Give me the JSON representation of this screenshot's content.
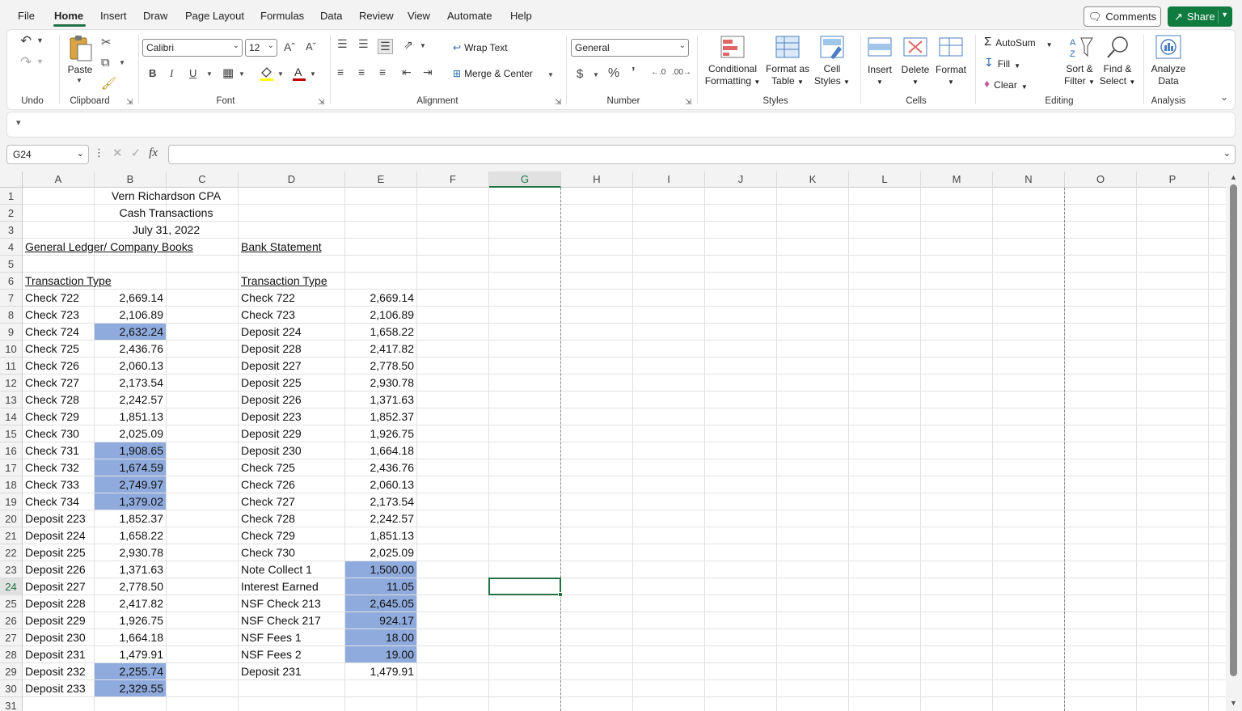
{
  "menu": {
    "tabs": [
      "File",
      "Home",
      "Insert",
      "Draw",
      "Page Layout",
      "Formulas",
      "Data",
      "Review",
      "View",
      "Automate",
      "Help"
    ],
    "active": "Home",
    "comments_label": "Comments",
    "share_label": "Share"
  },
  "ribbon": {
    "groups": {
      "undo": "Undo",
      "clipboard": "Clipboard",
      "font": "Font",
      "alignment": "Alignment",
      "number": "Number",
      "styles": "Styles",
      "cells": "Cells",
      "editing": "Editing",
      "analysis": "Analysis"
    },
    "paste_label": "Paste",
    "font_name": "Calibri",
    "font_size": "12",
    "wrap_text": "Wrap Text",
    "merge_center": "Merge & Center",
    "number_format": "General",
    "conditional_formatting": [
      "Conditional",
      "Formatting"
    ],
    "format_as_table": [
      "Format as",
      "Table"
    ],
    "cell_styles": [
      "Cell",
      "Styles"
    ],
    "insert": "Insert",
    "delete": "Delete",
    "format": "Format",
    "autosum": "AutoSum",
    "fill": "Fill",
    "clear": "Clear",
    "sort_filter": [
      "Sort &",
      "Filter"
    ],
    "find_select": [
      "Find &",
      "Select"
    ],
    "analyze_data": [
      "Analyze",
      "Data"
    ],
    "colors": {
      "accent": "#217346",
      "share": "#0f7b3f",
      "highlight": "#8faadc",
      "font_color": "#c00000",
      "fill_color": "#ffff00"
    }
  },
  "formula_bar": {
    "name_box": "G24",
    "formula": ""
  },
  "grid": {
    "columns": [
      "A",
      "B",
      "C",
      "D",
      "E",
      "F",
      "G",
      "H",
      "I",
      "J",
      "K",
      "L",
      "M",
      "N",
      "O",
      "P"
    ],
    "selected_column": "G",
    "selected_row": 24,
    "rows": [
      1,
      2,
      3,
      4,
      5,
      6,
      7,
      8,
      9,
      10,
      11,
      12,
      13,
      14,
      15,
      16,
      17,
      18,
      19,
      20,
      21,
      22,
      23,
      24,
      25,
      26,
      27,
      28,
      29,
      30,
      31
    ],
    "title": "Vern Richardson CPA",
    "subtitle": "Cash Transactions",
    "date": "July 31, 2022",
    "ledger_header": "General Ledger/ Company Books",
    "bank_header": "Bank Statement",
    "col_a_header": "Transaction Type",
    "col_d_header": "Transaction Type",
    "ledger": [
      {
        "row": 7,
        "type": "Check 722",
        "amount": "2,669.14",
        "highlight": false
      },
      {
        "row": 8,
        "type": "Check 723",
        "amount": "2,106.89",
        "highlight": false
      },
      {
        "row": 9,
        "type": "Check 724",
        "amount": "2,632.24",
        "highlight": true
      },
      {
        "row": 10,
        "type": "Check 725",
        "amount": "2,436.76",
        "highlight": false
      },
      {
        "row": 11,
        "type": "Check 726",
        "amount": "2,060.13",
        "highlight": false
      },
      {
        "row": 12,
        "type": "Check 727",
        "amount": "2,173.54",
        "highlight": false
      },
      {
        "row": 13,
        "type": "Check 728",
        "amount": "2,242.57",
        "highlight": false
      },
      {
        "row": 14,
        "type": "Check 729",
        "amount": "1,851.13",
        "highlight": false
      },
      {
        "row": 15,
        "type": "Check 730",
        "amount": "2,025.09",
        "highlight": false
      },
      {
        "row": 16,
        "type": "Check 731",
        "amount": "1,908.65",
        "highlight": true
      },
      {
        "row": 17,
        "type": "Check 732",
        "amount": "1,674.59",
        "highlight": true
      },
      {
        "row": 18,
        "type": "Check 733",
        "amount": "2,749.97",
        "highlight": true
      },
      {
        "row": 19,
        "type": "Check 734",
        "amount": "1,379.02",
        "highlight": true
      },
      {
        "row": 20,
        "type": "Deposit 223",
        "amount": "1,852.37",
        "highlight": false
      },
      {
        "row": 21,
        "type": "Deposit 224",
        "amount": "1,658.22",
        "highlight": false
      },
      {
        "row": 22,
        "type": "Deposit 225",
        "amount": "2,930.78",
        "highlight": false
      },
      {
        "row": 23,
        "type": "Deposit 226",
        "amount": "1,371.63",
        "highlight": false
      },
      {
        "row": 24,
        "type": "Deposit 227",
        "amount": "2,778.50",
        "highlight": false
      },
      {
        "row": 25,
        "type": "Deposit 228",
        "amount": "2,417.82",
        "highlight": false
      },
      {
        "row": 26,
        "type": "Deposit 229",
        "amount": "1,926.75",
        "highlight": false
      },
      {
        "row": 27,
        "type": "Deposit 230",
        "amount": "1,664.18",
        "highlight": false
      },
      {
        "row": 28,
        "type": "Deposit 231",
        "amount": "1,479.91",
        "highlight": false
      },
      {
        "row": 29,
        "type": "Deposit 232",
        "amount": "2,255.74",
        "highlight": true
      },
      {
        "row": 30,
        "type": "Deposit 233",
        "amount": "2,329.55",
        "highlight": true
      }
    ],
    "bank": [
      {
        "row": 7,
        "type": "Check 722",
        "amount": "2,669.14",
        "highlight": false
      },
      {
        "row": 8,
        "type": "Check 723",
        "amount": "2,106.89",
        "highlight": false
      },
      {
        "row": 9,
        "type": "Deposit 224",
        "amount": "1,658.22",
        "highlight": false
      },
      {
        "row": 10,
        "type": "Deposit 228",
        "amount": "2,417.82",
        "highlight": false
      },
      {
        "row": 11,
        "type": "Deposit 227",
        "amount": "2,778.50",
        "highlight": false
      },
      {
        "row": 12,
        "type": "Deposit 225",
        "amount": "2,930.78",
        "highlight": false
      },
      {
        "row": 13,
        "type": "Deposit 226",
        "amount": "1,371.63",
        "highlight": false
      },
      {
        "row": 14,
        "type": "Deposit 223",
        "amount": "1,852.37",
        "highlight": false
      },
      {
        "row": 15,
        "type": "Deposit 229",
        "amount": "1,926.75",
        "highlight": false
      },
      {
        "row": 16,
        "type": "Deposit 230",
        "amount": "1,664.18",
        "highlight": false
      },
      {
        "row": 17,
        "type": "Check 725",
        "amount": "2,436.76",
        "highlight": false
      },
      {
        "row": 18,
        "type": "Check 726",
        "amount": "2,060.13",
        "highlight": false
      },
      {
        "row": 19,
        "type": "Check 727",
        "amount": "2,173.54",
        "highlight": false
      },
      {
        "row": 20,
        "type": "Check 728",
        "amount": "2,242.57",
        "highlight": false
      },
      {
        "row": 21,
        "type": "Check 729",
        "amount": "1,851.13",
        "highlight": false
      },
      {
        "row": 22,
        "type": "Check 730",
        "amount": "2,025.09",
        "highlight": false
      },
      {
        "row": 23,
        "type": "Note Collect 1",
        "amount": "1,500.00",
        "highlight": true
      },
      {
        "row": 24,
        "type": "Interest Earned",
        "amount": "11.05",
        "highlight": true
      },
      {
        "row": 25,
        "type": "NSF Check 213",
        "amount": "2,645.05",
        "highlight": true
      },
      {
        "row": 26,
        "type": "NSF Check 217",
        "amount": "924.17",
        "highlight": true
      },
      {
        "row": 27,
        "type": "NSF Fees 1",
        "amount": "18.00",
        "highlight": true
      },
      {
        "row": 28,
        "type": "NSF Fees 2",
        "amount": "19.00",
        "highlight": true
      },
      {
        "row": 29,
        "type": "Deposit 231",
        "amount": "1,479.91",
        "highlight": false
      }
    ]
  }
}
